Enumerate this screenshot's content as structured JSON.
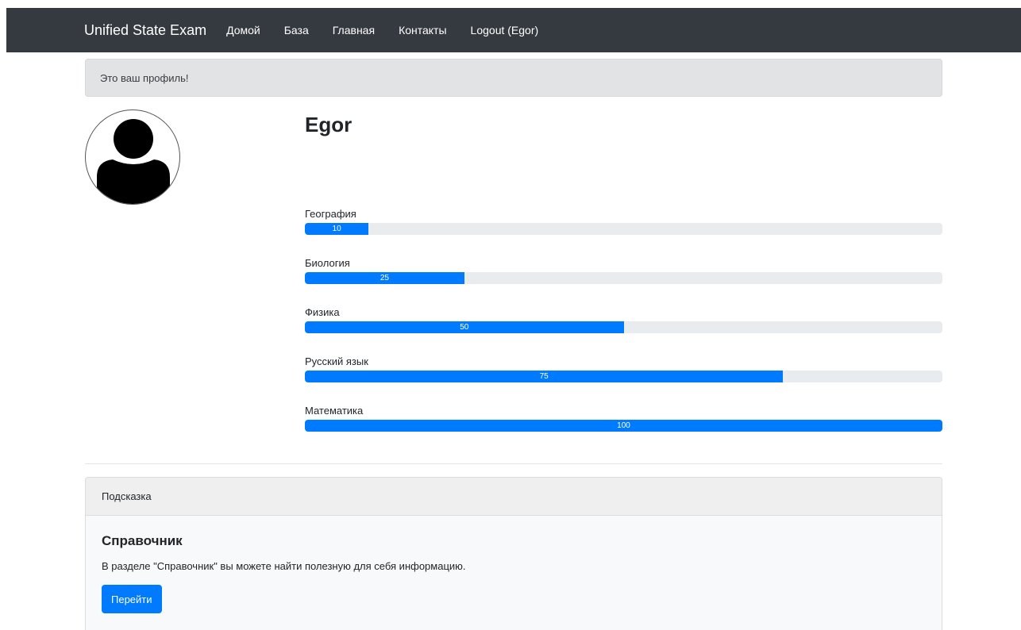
{
  "navbar": {
    "brand": "Unified State Exam",
    "links": [
      "Домой",
      "База",
      "Главная",
      "Контакты",
      "Logout (Egor)"
    ]
  },
  "alert": {
    "text": "Это ваш профиль!"
  },
  "profile": {
    "name": "Egor",
    "avatar_icon": "user-silhouette-icon",
    "subjects": [
      {
        "label": "География",
        "value": 10,
        "value_text": "10"
      },
      {
        "label": "Биология",
        "value": 25,
        "value_text": "25"
      },
      {
        "label": "Физика",
        "value": 50,
        "value_text": "50"
      },
      {
        "label": "Русский язык",
        "value": 75,
        "value_text": "75"
      },
      {
        "label": "Математика",
        "value": 100,
        "value_text": "100"
      }
    ]
  },
  "card": {
    "header": "Подсказка",
    "title": "Справочник",
    "text": "В разделе \"Справочник\" вы можете найти полезную для себя информацию.",
    "button_label": "Перейти"
  },
  "colors": {
    "navbar_bg": "#343a40",
    "accent": "#007bff",
    "progress_track": "#e9ecef",
    "alert_bg": "#e2e3e5"
  }
}
